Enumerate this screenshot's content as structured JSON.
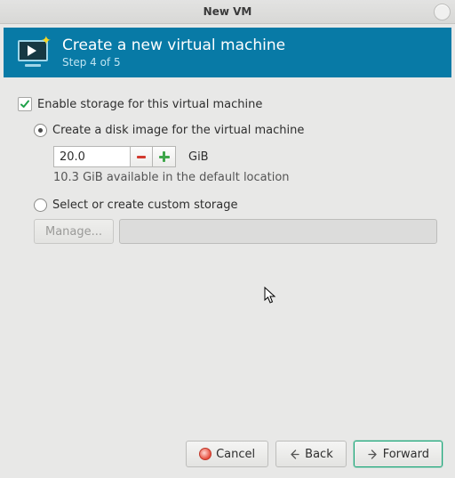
{
  "window": {
    "title": "New VM"
  },
  "banner": {
    "heading": "Create a new virtual machine",
    "step": "Step 4 of 5"
  },
  "storage": {
    "enable_label": "Enable storage for this virtual machine",
    "enabled": true,
    "create_disk_label": "Create a disk image for the virtual machine",
    "size_value": "20.0",
    "size_unit": "GiB",
    "available_hint": "10.3 GiB available in the default location",
    "custom_label": "Select or create custom storage",
    "manage_label": "Manage...",
    "custom_path": ""
  },
  "buttons": {
    "cancel": "Cancel",
    "back": "Back",
    "forward": "Forward"
  }
}
